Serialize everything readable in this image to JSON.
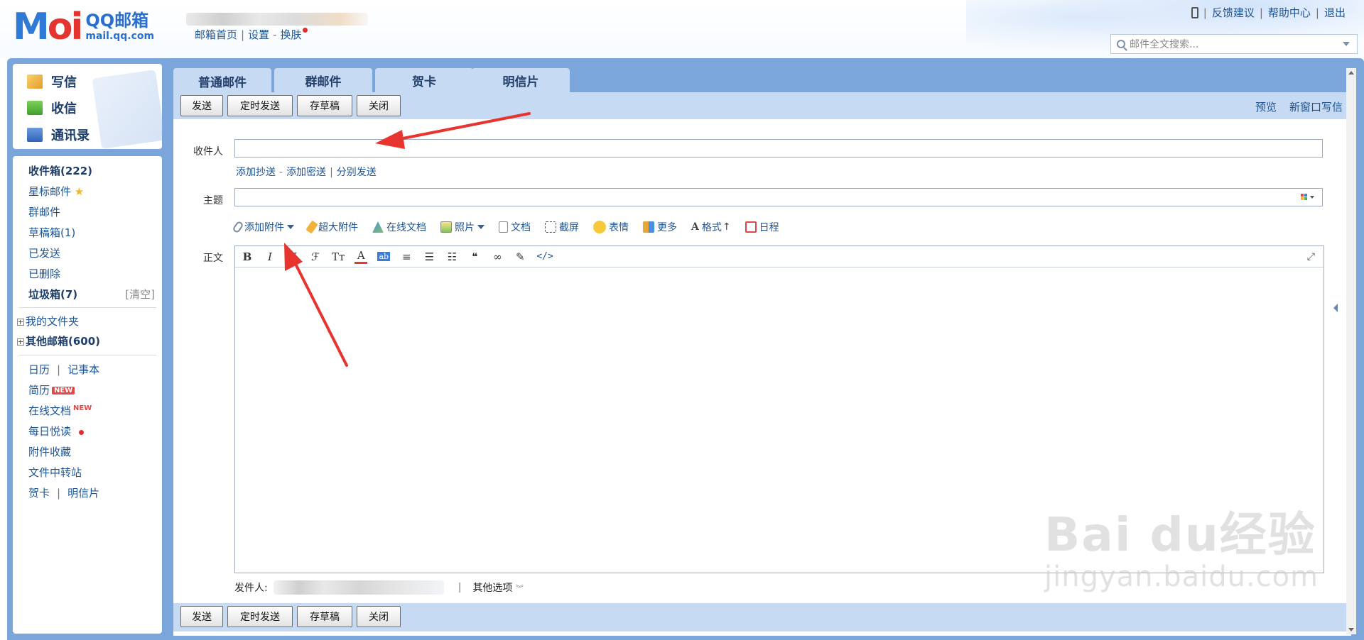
{
  "header": {
    "logo_mark_left": "M",
    "logo_mark_o": "oi",
    "logo_cn": "QQ邮箱",
    "logo_domain": "mail.qq.com",
    "links": [
      "邮箱首页",
      "设置",
      "换肤"
    ],
    "top_right": [
      "反馈建议",
      "帮助中心",
      "退出"
    ],
    "search_placeholder": "邮件全文搜索..."
  },
  "quick": [
    {
      "label": "写信"
    },
    {
      "label": "收信"
    },
    {
      "label": "通讯录"
    }
  ],
  "folders": {
    "inbox": "收件箱(222)",
    "starred": "星标邮件",
    "group": "群邮件",
    "drafts": "草稿箱(1)",
    "sent": "已发送",
    "deleted": "已删除",
    "junk": "垃圾箱(7)",
    "junk_clear": "[清空]",
    "my_folders": "我的文件夹",
    "other_mailboxes": "其他邮箱(600)",
    "calendar": "日历",
    "notes": "记事本",
    "resume": "简历",
    "new_badge": "NEW",
    "online_docs": "在线文档",
    "daily_read": "每日悦读",
    "attach_fav": "附件收藏",
    "file_transfer": "文件中转站",
    "cards": "贺卡",
    "postcards": "明信片"
  },
  "tabs": [
    "普通邮件",
    "群邮件",
    "贺卡",
    "明信片"
  ],
  "toolbar": {
    "send": "发送",
    "scheduled": "定时发送",
    "save_draft": "存草稿",
    "close": "关闭",
    "preview": "预览",
    "new_window": "新窗口写信"
  },
  "compose": {
    "to_label": "收件人",
    "add_cc": "添加抄送",
    "add_bcc": "添加密送",
    "separate_send": "分别发送",
    "subject_label": "主题",
    "body_label": "正文",
    "attach": "添加附件",
    "big_attach": "超大附件",
    "online_doc": "在线文档",
    "photo": "照片",
    "doc": "文档",
    "screenshot": "截屏",
    "emoji": "表情",
    "more": "更多",
    "format": "格式",
    "schedule": "日程",
    "sender_label": "发件人:",
    "other_options": "其他选项"
  },
  "editor_tools": [
    "B",
    "I",
    "U",
    "ℱ",
    "Tт",
    "A",
    "ab",
    "≡",
    "☰",
    "☷",
    "❝",
    "∞",
    "✎",
    "</>"
  ],
  "watermark": {
    "line1": "Bai du经验",
    "line2": "jingyan.baidu.com"
  },
  "colors": {
    "frame": "#7aa6dc",
    "bar": "#c6daf3",
    "link": "#1e5494",
    "arrow": "#e8342f"
  }
}
